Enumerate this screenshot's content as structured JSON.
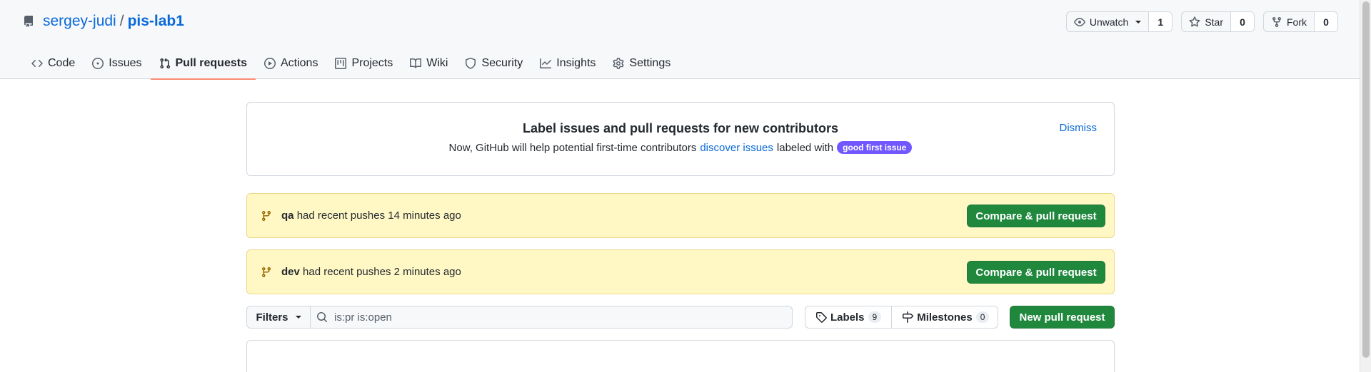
{
  "repo": {
    "owner": "sergey-judi",
    "separator": "/",
    "name": "pis-lab1"
  },
  "actions": {
    "watch": {
      "label": "Unwatch",
      "count": "1"
    },
    "star": {
      "label": "Star",
      "count": "0"
    },
    "fork": {
      "label": "Fork",
      "count": "0"
    }
  },
  "tabs": [
    {
      "label": "Code",
      "icon": "code-icon"
    },
    {
      "label": "Issues",
      "icon": "issue-icon"
    },
    {
      "label": "Pull requests",
      "icon": "pull-request-icon"
    },
    {
      "label": "Actions",
      "icon": "play-icon"
    },
    {
      "label": "Projects",
      "icon": "project-icon"
    },
    {
      "label": "Wiki",
      "icon": "book-icon"
    },
    {
      "label": "Security",
      "icon": "shield-icon"
    },
    {
      "label": "Insights",
      "icon": "graph-icon"
    },
    {
      "label": "Settings",
      "icon": "gear-icon"
    }
  ],
  "active_tab": "Pull requests",
  "callout": {
    "title": "Label issues and pull requests for new contributors",
    "desc_prefix": "Now, GitHub will help potential first-time contributors",
    "desc_link": "discover issues",
    "desc_suffix": "labeled with",
    "label": "good first issue",
    "dismiss": "Dismiss"
  },
  "pushes": [
    {
      "branch": "qa",
      "text": "had recent pushes 14 minutes ago",
      "button": "Compare & pull request"
    },
    {
      "branch": "dev",
      "text": "had recent pushes 2 minutes ago",
      "button": "Compare & pull request"
    }
  ],
  "filterbar": {
    "filters": "Filters",
    "search_value": "is:pr is:open",
    "labels": "Labels",
    "labels_count": "9",
    "milestones": "Milestones",
    "milestones_count": "0",
    "new_pr": "New pull request"
  },
  "colors": {
    "accent": "#0969da",
    "green": "#1f883d",
    "active_tab_underline": "#fd8c73",
    "push_bg": "#fff8c5",
    "label_good_first_issue": "#7057ff"
  }
}
